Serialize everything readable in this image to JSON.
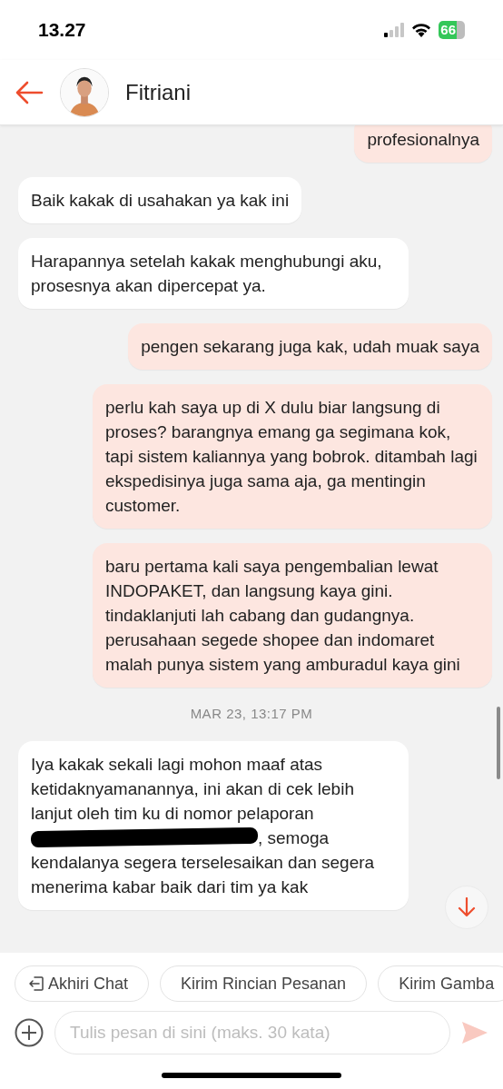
{
  "status_bar": {
    "time": "13.27",
    "battery": "66"
  },
  "header": {
    "contact_name": "Fitriani"
  },
  "messages": [
    {
      "kind": "sent",
      "text": "profesionalnya"
    },
    {
      "kind": "received",
      "text": "Baik kakak di usahakan ya kak ini"
    },
    {
      "kind": "received",
      "text": "Harapannya setelah kakak menghubungi aku, prosesnya akan dipercepat ya."
    },
    {
      "kind": "sent",
      "text": "pengen sekarang juga kak, udah muak saya"
    },
    {
      "kind": "sent",
      "text": "perlu kah saya up di X dulu biar langsung di proses? barangnya emang ga segimana kok, tapi sistem kaliannya yang bobrok. ditambah lagi ekspedisinya juga sama aja, ga mentingin customer."
    },
    {
      "kind": "sent",
      "text": "baru pertama kali saya pengembalian lewat INDOPAKET, dan langsung kaya gini. tindaklanjuti lah cabang dan gudangnya. perusahaan segede shopee dan indomaret malah punya sistem yang amburadul kaya gini"
    },
    {
      "kind": "timestamp",
      "text": "MAR 23, 13:17 PM"
    },
    {
      "kind": "redacted",
      "text": "Iya kakak sekali lagi mohon maaf atas ketidaknyamanannya, ini akan di cek lebih lanjut oleh tim ku di nomor pelaporan",
      "text_after": ", semoga",
      "text_end": "kendalanya segera terselesaikan dan segera menerima kabar baik dari tim ya kak"
    }
  ],
  "quick_replies": [
    {
      "label": "Akhiri Chat"
    },
    {
      "label": "Kirim Rincian Pesanan"
    },
    {
      "label": "Kirim Gamba"
    }
  ],
  "composer": {
    "placeholder": "Tulis pesan di sini (maks. 30 kata)"
  }
}
